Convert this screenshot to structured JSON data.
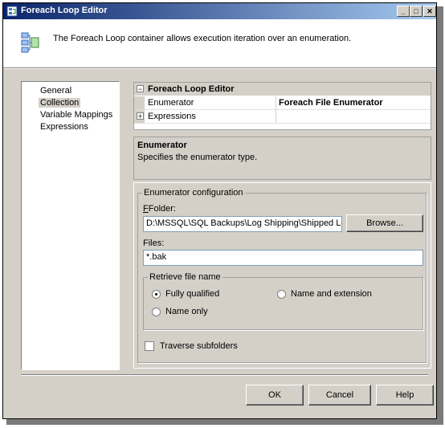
{
  "window": {
    "title": "Foreach Loop Editor",
    "minimize_glyph": "_",
    "maximize_glyph": "□",
    "close_glyph": "✕"
  },
  "header": {
    "description": "The Foreach Loop container allows execution iteration over an enumeration."
  },
  "nav": {
    "items": [
      "General",
      "Collection",
      "Variable Mappings",
      "Expressions"
    ],
    "selected": "Collection"
  },
  "property_grid": {
    "category": "Foreach Loop Editor",
    "collapse_glyph": "−",
    "expand_glyph": "+",
    "rows": [
      {
        "name": "Enumerator",
        "value": "Foreach File Enumerator"
      },
      {
        "name": "Expressions",
        "value": ""
      }
    ]
  },
  "description_panel": {
    "title": "Enumerator",
    "text": "Specifies the enumerator type."
  },
  "config": {
    "group_label": "Enumerator configuration",
    "folder_label": "Folder:",
    "folder_value": "D:\\MSSQL\\SQL Backups\\Log Shipping\\Shipped Logs",
    "browse_label": "Browse...",
    "files_label": "Files:",
    "files_value": "*.bak",
    "retrieve_label": "Retrieve file name",
    "options": [
      "Fully qualified",
      "Name and extension",
      "Name only"
    ],
    "selected_option": "Fully qualified",
    "traverse_label": "Traverse subfolders",
    "traverse_checked": false
  },
  "footer": {
    "ok": "OK",
    "cancel": "Cancel",
    "help": "Help"
  }
}
